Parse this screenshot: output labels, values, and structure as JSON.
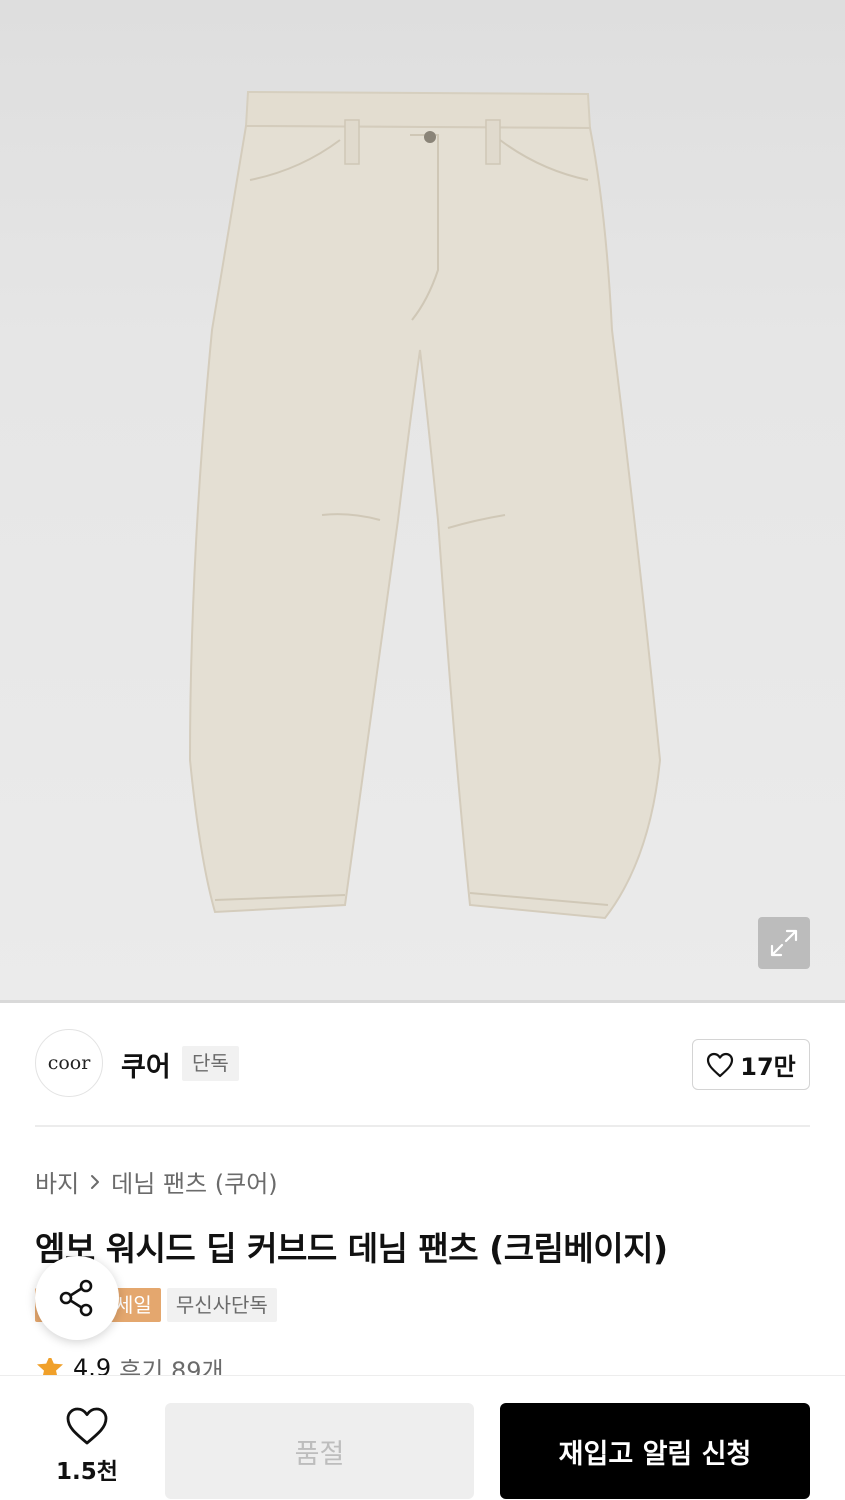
{
  "brand": {
    "logo_text": "coor",
    "name": "쿠어",
    "badge": "단독",
    "like_count": "17만"
  },
  "breadcrumb": {
    "category": "바지",
    "subcategory": "데님 팬츠 (쿠어)"
  },
  "product": {
    "title": "엠보 워시드 딥 커브드 데님 팬츠 (크림베이지)",
    "tags": [
      {
        "label": "세일",
        "color": "#e4a76e"
      },
      {
        "label": "무신사단독",
        "color": "#f1f1f1"
      }
    ],
    "rating": "4.9",
    "review_count": "후기 89개"
  },
  "bottom_bar": {
    "wish_count": "1.5천",
    "soldout_label": "품절",
    "restock_label": "재입고 알림 신청"
  },
  "icons": [
    "expand-icon",
    "heart-icon",
    "chevron-right-icon",
    "share-icon",
    "star-icon"
  ],
  "colors": {
    "pants": "#e4dfd3",
    "tag_sale": "#e4a76e",
    "cta": "#000000",
    "star": "#f0a02a"
  }
}
